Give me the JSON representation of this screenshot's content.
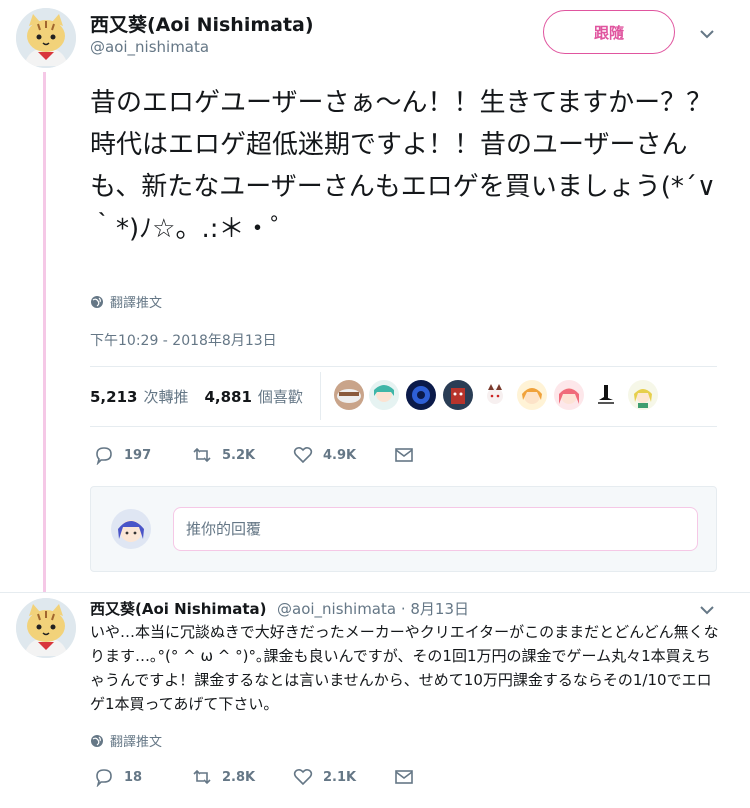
{
  "main_tweet": {
    "author_name": "西又葵(Aoi Nishimata)",
    "author_handle": "@aoi_nishimata",
    "follow_label": "跟隨",
    "text": "昔のエロゲユーザーさぁ～ん！！生きてますかー？？時代はエロゲ超低迷期ですよ！！昔のユーザーさんも、新たなユーザーさんもエロゲを買いましょう(*´∨｀*)ﾉ☆。.:＊・゜",
    "translate_label": "翻譯推文",
    "timestamp": "下午10:29 - 2018年8月13日",
    "retweets_count": "5,213",
    "retweets_label": "次轉推",
    "likes_count": "4,881",
    "likes_label": "個喜歡",
    "actions": {
      "reply_count": "197",
      "retweet_count": "5.2K",
      "like_count": "4.9K"
    }
  },
  "reply_box": {
    "placeholder": "推你的回覆"
  },
  "reply_tweet": {
    "author_name": "西又葵(Aoi Nishimata)",
    "meta": "@aoi_nishimata · 8月13日",
    "text": "いや…本当に冗談ぬきで大好きだったメーカーやクリエイターがこのままだとどんどん無くなります…｡°(° ^ ω ^ °)°｡課金も良いんですが、その1回1万円の課金でゲーム丸々1本買えちゃうんですよ！課金するなとは言いませんから、せめて10万円課金するならその1/10でエロゲ1本買ってあげて下さい。",
    "translate_label": "翻譯推文",
    "actions": {
      "reply_count": "18",
      "retweet_count": "2.8K",
      "like_count": "2.1K"
    }
  },
  "colors": {
    "accent_pink": "#e0559f",
    "thread_line": "#f5c8e6",
    "muted_text": "#657786"
  }
}
